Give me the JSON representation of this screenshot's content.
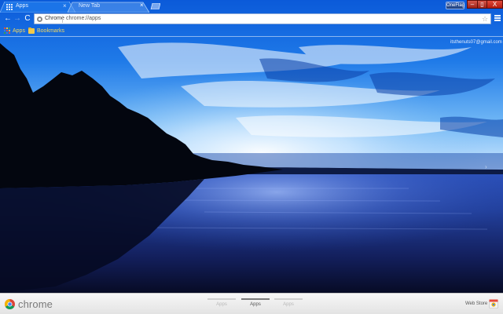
{
  "tabs": [
    {
      "title": "Apps",
      "close": "×",
      "active": true
    },
    {
      "title": "New Tab",
      "close": "×",
      "active": false
    }
  ],
  "window": {
    "user_badge": "OneFlag",
    "minimize": "–",
    "maximize": "▯",
    "close": "X"
  },
  "toolbar": {
    "back": "←",
    "forward": "→",
    "reload": "C",
    "site_label": "Chrome",
    "url": "chrome://apps",
    "bookmark_star": "☆"
  },
  "bookmarks": {
    "apps_label": "Apps",
    "bookmarks_label": "Bookmarks"
  },
  "account": {
    "email": "itsthenuts07@gmail.com"
  },
  "side_arrow": "›",
  "bottom": {
    "logo_text": "chrome",
    "pages": [
      {
        "label": "Apps",
        "active": false
      },
      {
        "label": "Apps",
        "active": true
      },
      {
        "label": "Apps",
        "active": false
      }
    ],
    "webstore_label": "Web Store"
  },
  "colors": {
    "tab_blue": "#1a6ae0",
    "toolbar_blue": "#2a7ff0",
    "bookmark_text": "#f6d85a",
    "close_red": "#c62a1c"
  }
}
